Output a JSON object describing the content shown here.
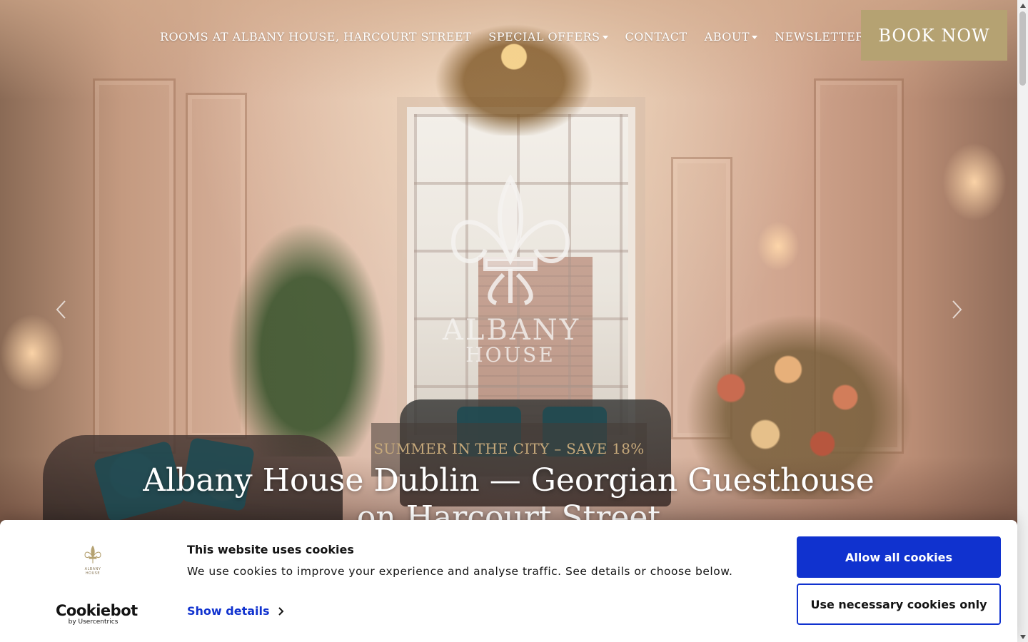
{
  "nav": {
    "items": [
      {
        "label": "ROOMS AT ALBANY HOUSE, HARCOURT STREET",
        "dropdown": false
      },
      {
        "label": "SPECIAL OFFERS",
        "dropdown": true
      },
      {
        "label": "CONTACT",
        "dropdown": false
      },
      {
        "label": "ABOUT",
        "dropdown": true
      },
      {
        "label": "NEWSLETTER SIGN UP",
        "dropdown": false
      }
    ],
    "book_label": "BOOK NOW"
  },
  "hero": {
    "logo_line1": "ALBANY",
    "logo_line2": "HOUSE",
    "promo": "SUMMER IN THE CITY – SAVE 18%",
    "headline": "Albany House Dublin — Georgian Guesthouse on Harcourt Street"
  },
  "cookie": {
    "logo_text": "ALBANY HOUSE",
    "title": "This website uses cookies",
    "description": "We use cookies to improve your experience and analyse traffic. See details or choose below.",
    "show_details": "Show details",
    "allow_all": "Allow all cookies",
    "necessary_only": "Use necessary cookies only",
    "brand": "Cookiebot",
    "brand_sub": "by Usercentrics"
  },
  "colors": {
    "accent_gold": "#b5a272",
    "promo_text": "#c6a97b",
    "cookie_blue": "#1032cf"
  },
  "icons": [
    "fleur-de-lis-icon",
    "chevron-left-icon",
    "chevron-right-icon",
    "caret-down-icon",
    "chevron-right-small-icon"
  ]
}
